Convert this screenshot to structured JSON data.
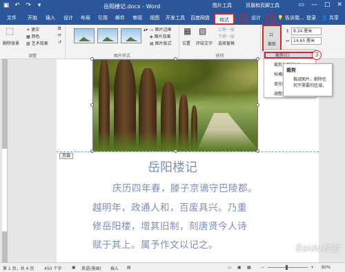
{
  "titlebar": {
    "title": "岳阳楼记.docx - Word",
    "context_tab_1": "图片工具",
    "context_tab_2": "页眉和页脚工具",
    "qat_icons": [
      "save-icon",
      "undo-icon",
      "redo-icon",
      "customize-icon"
    ]
  },
  "tabs": {
    "items": [
      "文件",
      "开始",
      "插入",
      "设计",
      "布局",
      "引用",
      "邮件",
      "审阅",
      "视图",
      "开发工具",
      "百度网盘",
      "格式",
      "设计"
    ],
    "active": "格式",
    "search_placeholder": "告诉我...",
    "login": "登录",
    "share": "共享"
  },
  "annotations": {
    "n1": "1",
    "n2": "2",
    "n3": "3"
  },
  "ribbon": {
    "remove_bg": "删除背景",
    "correct": "更正",
    "color": "颜色",
    "art_effect": "艺术效果",
    "adjust_label": "调整",
    "picture_styles_label": "图片样式",
    "border": "图片边框",
    "effect": "图片效果",
    "layout": "图片版式",
    "position": "位置",
    "wrap_text": "环绕文字",
    "bring_forward": "上移一层",
    "send_backward": "下移一层",
    "selection_pane": "选择窗格",
    "arrange_label": "排列",
    "crop": "裁剪",
    "height": "8.24 厘米",
    "width": "14.65 厘米",
    "size_label": "大小"
  },
  "dropdown": {
    "items": [
      "裁剪(C)",
      "裁剪为形状(S)",
      "纵横比(A)",
      "填充(L)",
      "调整(T)"
    ]
  },
  "tooltip": {
    "title": "裁剪",
    "description": "裁减图片，删除任何不需要的区域。"
  },
  "document": {
    "header_tag": "页眉",
    "title": "岳阳楼记",
    "lines": [
      "庆历四年春，滕子京谪守巴陵郡。",
      "越明年，政通人和，百废具兴。乃重",
      "修岳阳楼，增其旧制，刻唐贤今人诗",
      "赋于其上。属予作文以记之。"
    ]
  },
  "status": {
    "page": "第 1 页，共 4 页",
    "words": "450 个字",
    "language": "英语(美国)",
    "mode": "插入",
    "zoom": "80%"
  },
  "watermark": "Baidu经验"
}
